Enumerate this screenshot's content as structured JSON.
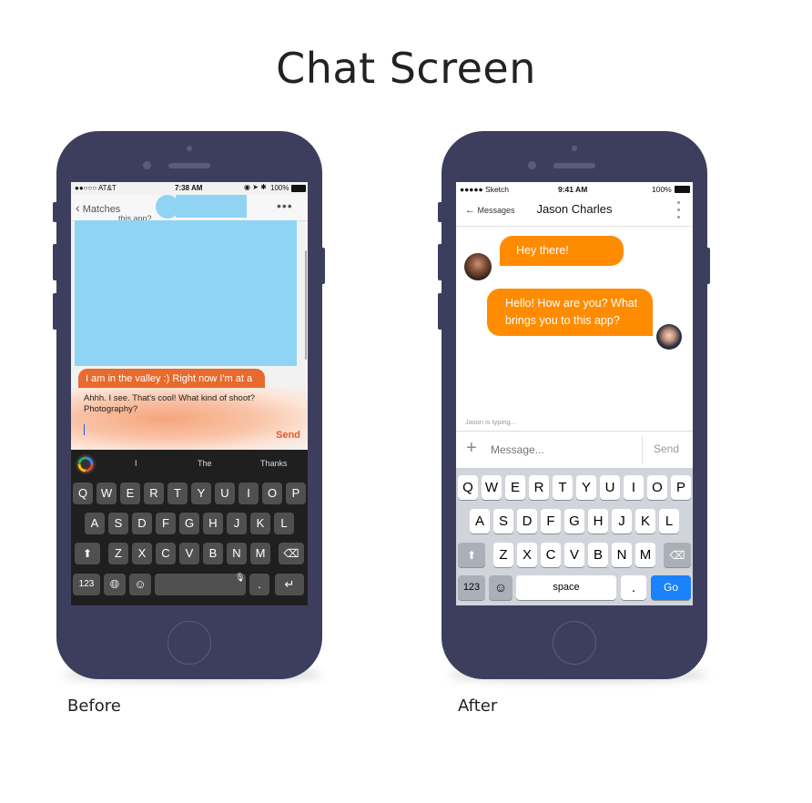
{
  "page": {
    "title": "Chat Screen",
    "before_caption": "Before",
    "after_caption": "After"
  },
  "before": {
    "status": {
      "carrier": "●●○○○ AT&T",
      "time": "7:38 AM",
      "battery": "100%"
    },
    "nav": {
      "back_label": "Matches",
      "more": "•••"
    },
    "header_partial_text": "this app?",
    "messages": {
      "incoming_partial": "I am in the valley :) Right now I'm at a",
      "outgoing": "Ahhh. I see. That's cool! What kind of shoot? Photography?"
    },
    "send_label": "Send",
    "suggestions": [
      "I",
      "The",
      "Thanks"
    ],
    "keyboard": {
      "row1": [
        "Q",
        "W",
        "E",
        "R",
        "T",
        "Y",
        "U",
        "I",
        "O",
        "P"
      ],
      "row2": [
        "A",
        "S",
        "D",
        "F",
        "G",
        "H",
        "J",
        "K",
        "L"
      ],
      "row3": [
        "Z",
        "X",
        "C",
        "V",
        "B",
        "N",
        "M"
      ],
      "numbers": "123",
      "period": "."
    },
    "colors": {
      "bubble": "#e86a2c",
      "redaction": "#8fd4f5"
    }
  },
  "after": {
    "status": {
      "carrier": "●●●●● Sketch",
      "time": "9:41 AM",
      "battery": "100%"
    },
    "nav": {
      "back_label": "Messages",
      "contact_name": "Jason Charles"
    },
    "messages": {
      "incoming": "Hey there!",
      "outgoing": "Hello! How are you? What brings you to this app?"
    },
    "typing_indicator": "Jason is typing...",
    "composer": {
      "placeholder": "Message...",
      "send_label": "Send"
    },
    "keyboard": {
      "row1": [
        "Q",
        "W",
        "E",
        "R",
        "T",
        "Y",
        "U",
        "I",
        "O",
        "P"
      ],
      "row2": [
        "A",
        "S",
        "D",
        "F",
        "G",
        "H",
        "J",
        "K",
        "L"
      ],
      "row3": [
        "Z",
        "X",
        "C",
        "V",
        "B",
        "N",
        "M"
      ],
      "numbers": "123",
      "space": "space",
      "period": ".",
      "go": "Go"
    },
    "colors": {
      "bubble": "#ff8c00",
      "go_key": "#1a82fb"
    }
  }
}
